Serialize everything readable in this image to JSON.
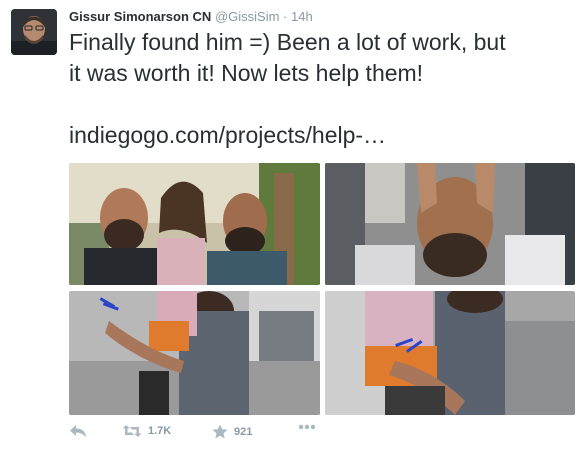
{
  "tweet": {
    "author_name": "Gissur Simonarson CN",
    "author_handle": "@GissiSim",
    "separator": "·",
    "time": "14h",
    "text_line1": "Finally found him =) Been a lot of work, but",
    "text_line2": "it was worth it! Now lets help them!",
    "link": "indiegogo.com/projects/help-…"
  },
  "actions": {
    "retweet_count": "1.7K",
    "favorite_count": "921"
  },
  "icons": [
    "avatar",
    "reply-icon",
    "retweet-icon",
    "favorite-star-icon",
    "more-icon"
  ],
  "colors": {
    "text": "#292f33",
    "muted": "#8899a6"
  }
}
